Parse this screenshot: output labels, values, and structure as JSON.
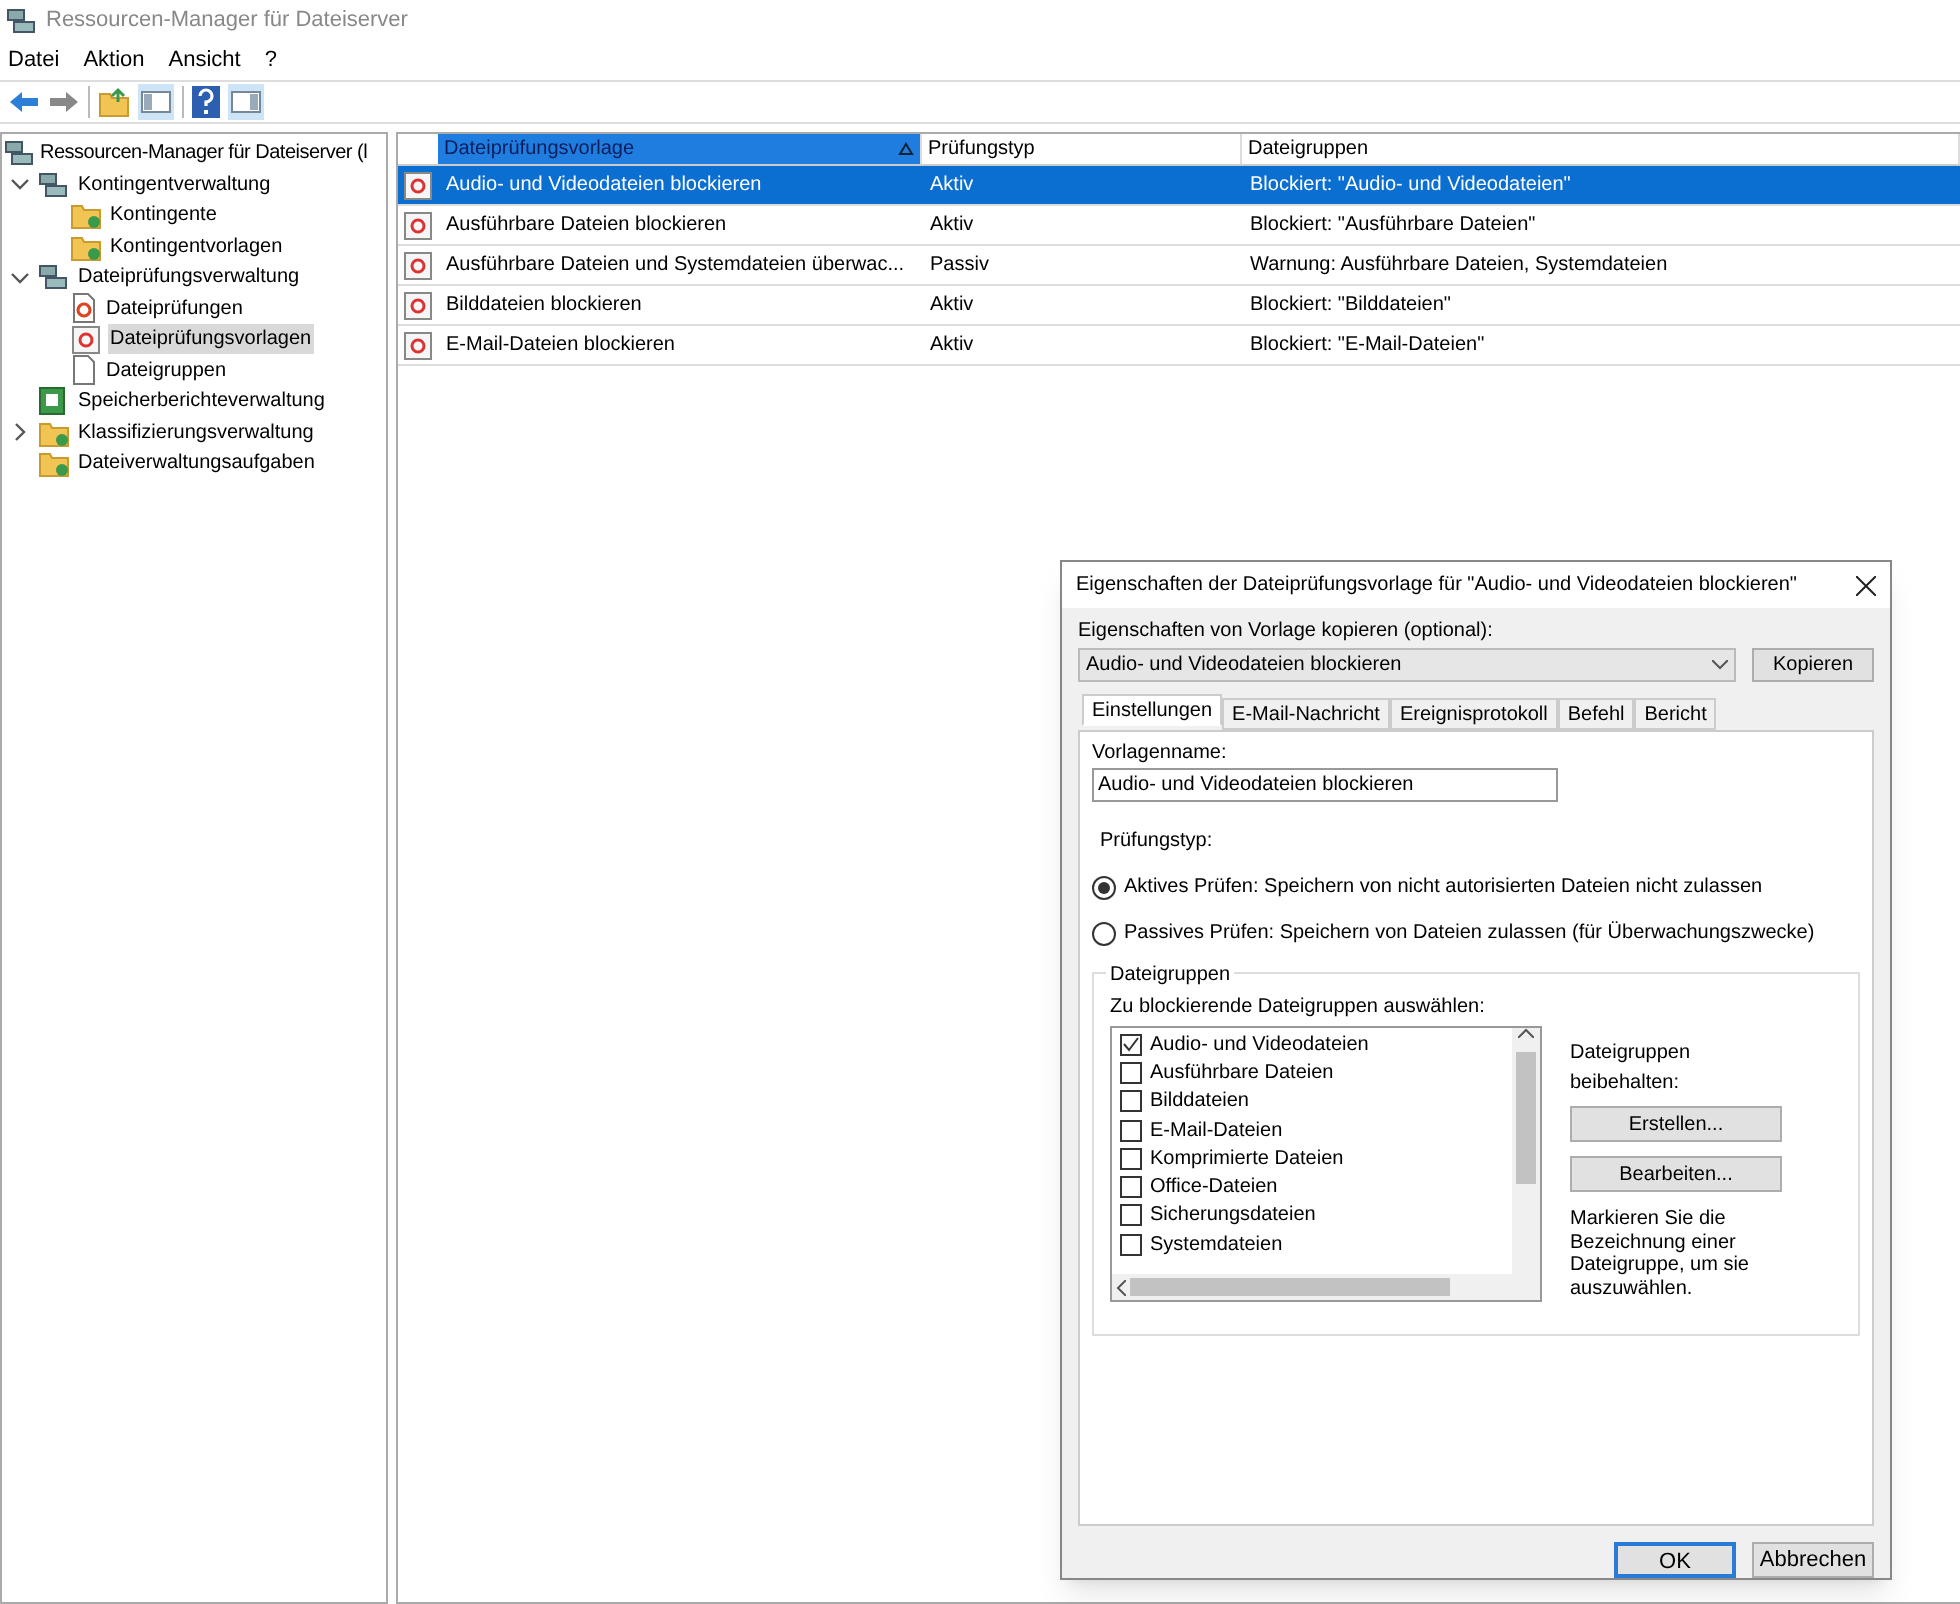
{
  "window": {
    "title": "Ressourcen-Manager für Dateiserver"
  },
  "menu": [
    "Datei",
    "Aktion",
    "Ansicht",
    "?"
  ],
  "tree": {
    "label": "Ressourcen-Manager für Dateiserver (l",
    "selected": false,
    "children": [
      {
        "label": "Kontingentverwaltung",
        "selected": false,
        "expanded": true,
        "children": [
          {
            "label": "Kontingente",
            "selected": false
          },
          {
            "label": "Kontingentvorlagen",
            "selected": false
          }
        ]
      },
      {
        "label": "Dateiprüfungsverwaltung",
        "selected": false,
        "expanded": true,
        "children": [
          {
            "label": "Dateiprüfungen",
            "selected": false
          },
          {
            "label": "Dateiprüfungsvorlagen",
            "selected": true
          },
          {
            "label": "Dateigruppen",
            "selected": false
          }
        ]
      },
      {
        "label": "Speicherberichteverwaltung",
        "selected": false
      },
      {
        "label": "Klassifizierungsverwaltung",
        "selected": false,
        "expanded": false
      },
      {
        "label": "Dateiverwaltungsaufgaben",
        "selected": false
      }
    ]
  },
  "table": {
    "columns": [
      "Dateiprüfungsvorlage",
      "Prüfungstyp",
      "Dateigruppen"
    ],
    "rows": [
      {
        "cells": [
          "Audio- und Videodateien blockieren",
          "Aktiv",
          "Blockiert: \"Audio- und Videodateien\""
        ],
        "selected": true
      },
      {
        "cells": [
          "Ausführbare Dateien blockieren",
          "Aktiv",
          "Blockiert: \"Ausführbare Dateien\""
        ],
        "selected": false
      },
      {
        "cells": [
          "Ausführbare Dateien und Systemdateien überwac...",
          "Passiv",
          "Warnung: Ausführbare Dateien, Systemdateien"
        ],
        "selected": false
      },
      {
        "cells": [
          "Bilddateien blockieren",
          "Aktiv",
          "Blockiert: \"Bilddateien\""
        ],
        "selected": false
      },
      {
        "cells": [
          "E-Mail-Dateien blockieren",
          "Aktiv",
          "Blockiert: \"E-Mail-Dateien\""
        ],
        "selected": false
      }
    ]
  },
  "dialog": {
    "title": "Eigenschaften der Dateiprüfungsvorlage für \"Audio- und Videodateien blockieren\"",
    "copy_label": "Eigenschaften von Vorlage kopieren (optional):",
    "copy_value": "Audio- und Videodateien blockieren",
    "copy_button": "Kopieren",
    "tabs": [
      {
        "label": "Einstellungen",
        "selected": true
      },
      {
        "label": "E-Mail-Nachricht",
        "selected": false
      },
      {
        "label": "Ereignisprotokoll",
        "selected": false
      },
      {
        "label": "Befehl",
        "selected": false
      },
      {
        "label": "Bericht",
        "selected": false
      }
    ],
    "name_label": "Vorlagenname:",
    "name_value": "Audio- und Videodateien blockieren",
    "type_label": "Prüfungstyp:",
    "radios": [
      {
        "label": "Aktives Prüfen: Speichern von nicht autorisierten Dateien nicht zulassen",
        "selected": true
      },
      {
        "label": "Passives Prüfen: Speichern von Dateien zulassen (für Überwachungszwecke)",
        "selected": false
      }
    ],
    "group_title": "Dateigruppen",
    "list_label": "Zu blockierende Dateigruppen auswählen:",
    "file_groups": [
      {
        "label": "Audio- und Videodateien",
        "checked": true
      },
      {
        "label": "Ausführbare Dateien",
        "checked": false
      },
      {
        "label": "Bilddateien",
        "checked": false
      },
      {
        "label": "E-Mail-Dateien",
        "checked": false
      },
      {
        "label": "Komprimierte Dateien",
        "checked": false
      },
      {
        "label": "Office-Dateien",
        "checked": false
      },
      {
        "label": "Sicherungsdateien",
        "checked": false
      },
      {
        "label": "Systemdateien",
        "checked": false
      }
    ],
    "manage_label": "Dateigruppen beibehalten:",
    "create_button": "Erstellen...",
    "edit_button": "Bearbeiten...",
    "hint": "Markieren Sie die Bezeichnung einer Dateigruppe, um sie auszuwählen.",
    "buttons": [
      {
        "label": "OK",
        "kind": "default"
      },
      {
        "label": "Abbrechen",
        "kind": "normal"
      }
    ]
  }
}
